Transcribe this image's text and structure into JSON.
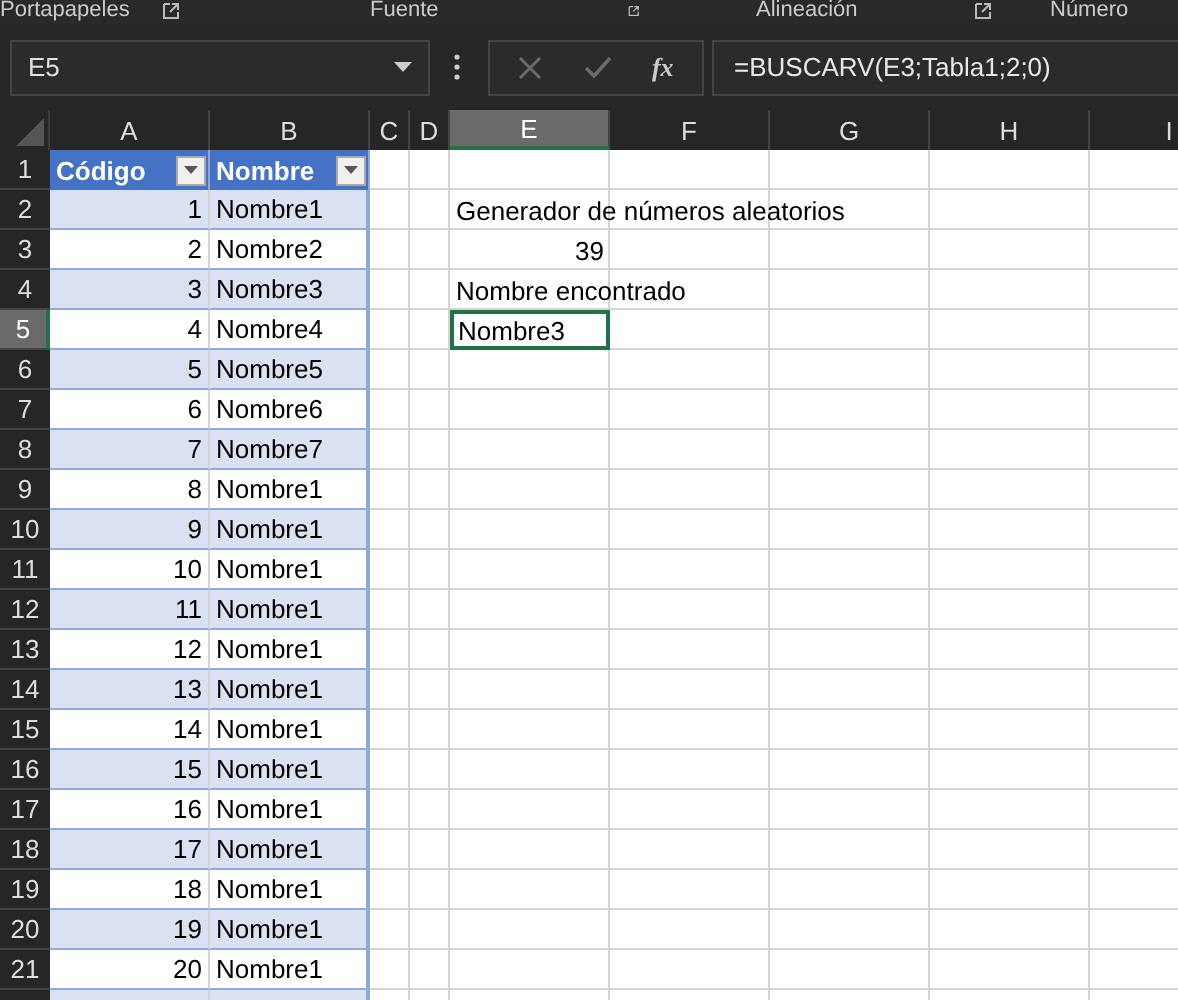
{
  "ribbon_groups": [
    {
      "label": "Portapapeles"
    },
    {
      "label": "Fuente"
    },
    {
      "label": "Alineación"
    },
    {
      "label": "Número"
    }
  ],
  "name_box": {
    "value": "E5"
  },
  "formula_bar": {
    "value": "=BUSCARV(E3;Tabla1;2;0)",
    "function_icon": "fx"
  },
  "columns": [
    {
      "label": "A",
      "selected": false
    },
    {
      "label": "B",
      "selected": false
    },
    {
      "label": "C",
      "selected": false
    },
    {
      "label": "D",
      "selected": false
    },
    {
      "label": "E",
      "selected": true
    },
    {
      "label": "F",
      "selected": false
    },
    {
      "label": "G",
      "selected": false
    },
    {
      "label": "H",
      "selected": false
    },
    {
      "label": "I",
      "selected": false
    }
  ],
  "row_headers": [
    {
      "label": "1",
      "selected": false
    },
    {
      "label": "2",
      "selected": false
    },
    {
      "label": "3",
      "selected": false
    },
    {
      "label": "4",
      "selected": false
    },
    {
      "label": "5",
      "selected": true
    },
    {
      "label": "6",
      "selected": false
    },
    {
      "label": "7",
      "selected": false
    },
    {
      "label": "8",
      "selected": false
    },
    {
      "label": "9",
      "selected": false
    },
    {
      "label": "10",
      "selected": false
    },
    {
      "label": "11",
      "selected": false
    },
    {
      "label": "12",
      "selected": false
    },
    {
      "label": "13",
      "selected": false
    },
    {
      "label": "14",
      "selected": false
    },
    {
      "label": "15",
      "selected": false
    },
    {
      "label": "16",
      "selected": false
    },
    {
      "label": "17",
      "selected": false
    },
    {
      "label": "18",
      "selected": false
    },
    {
      "label": "19",
      "selected": false
    },
    {
      "label": "20",
      "selected": false
    },
    {
      "label": "21",
      "selected": false
    }
  ],
  "table": {
    "headers": [
      "Código",
      "Nombre"
    ],
    "rows": [
      [
        "1",
        "Nombre1"
      ],
      [
        "2",
        "Nombre2"
      ],
      [
        "3",
        "Nombre3"
      ],
      [
        "4",
        "Nombre4"
      ],
      [
        "5",
        "Nombre5"
      ],
      [
        "6",
        "Nombre6"
      ],
      [
        "7",
        "Nombre7"
      ],
      [
        "8",
        "Nombre1"
      ],
      [
        "9",
        "Nombre1"
      ],
      [
        "10",
        "Nombre1"
      ],
      [
        "11",
        "Nombre1"
      ],
      [
        "12",
        "Nombre1"
      ],
      [
        "13",
        "Nombre1"
      ],
      [
        "14",
        "Nombre1"
      ],
      [
        "15",
        "Nombre1"
      ],
      [
        "16",
        "Nombre1"
      ],
      [
        "17",
        "Nombre1"
      ],
      [
        "18",
        "Nombre1"
      ],
      [
        "19",
        "Nombre1"
      ],
      [
        "20",
        "Nombre1"
      ]
    ]
  },
  "column_e": [
    {
      "value": "Generador de números aleatorios",
      "kind": "text",
      "selected": false
    },
    {
      "value": "39",
      "kind": "number",
      "selected": false
    },
    {
      "value": "Nombre encontrado",
      "kind": "text",
      "selected": false
    },
    {
      "value": "Nombre3",
      "kind": "text",
      "selected": true
    }
  ]
}
